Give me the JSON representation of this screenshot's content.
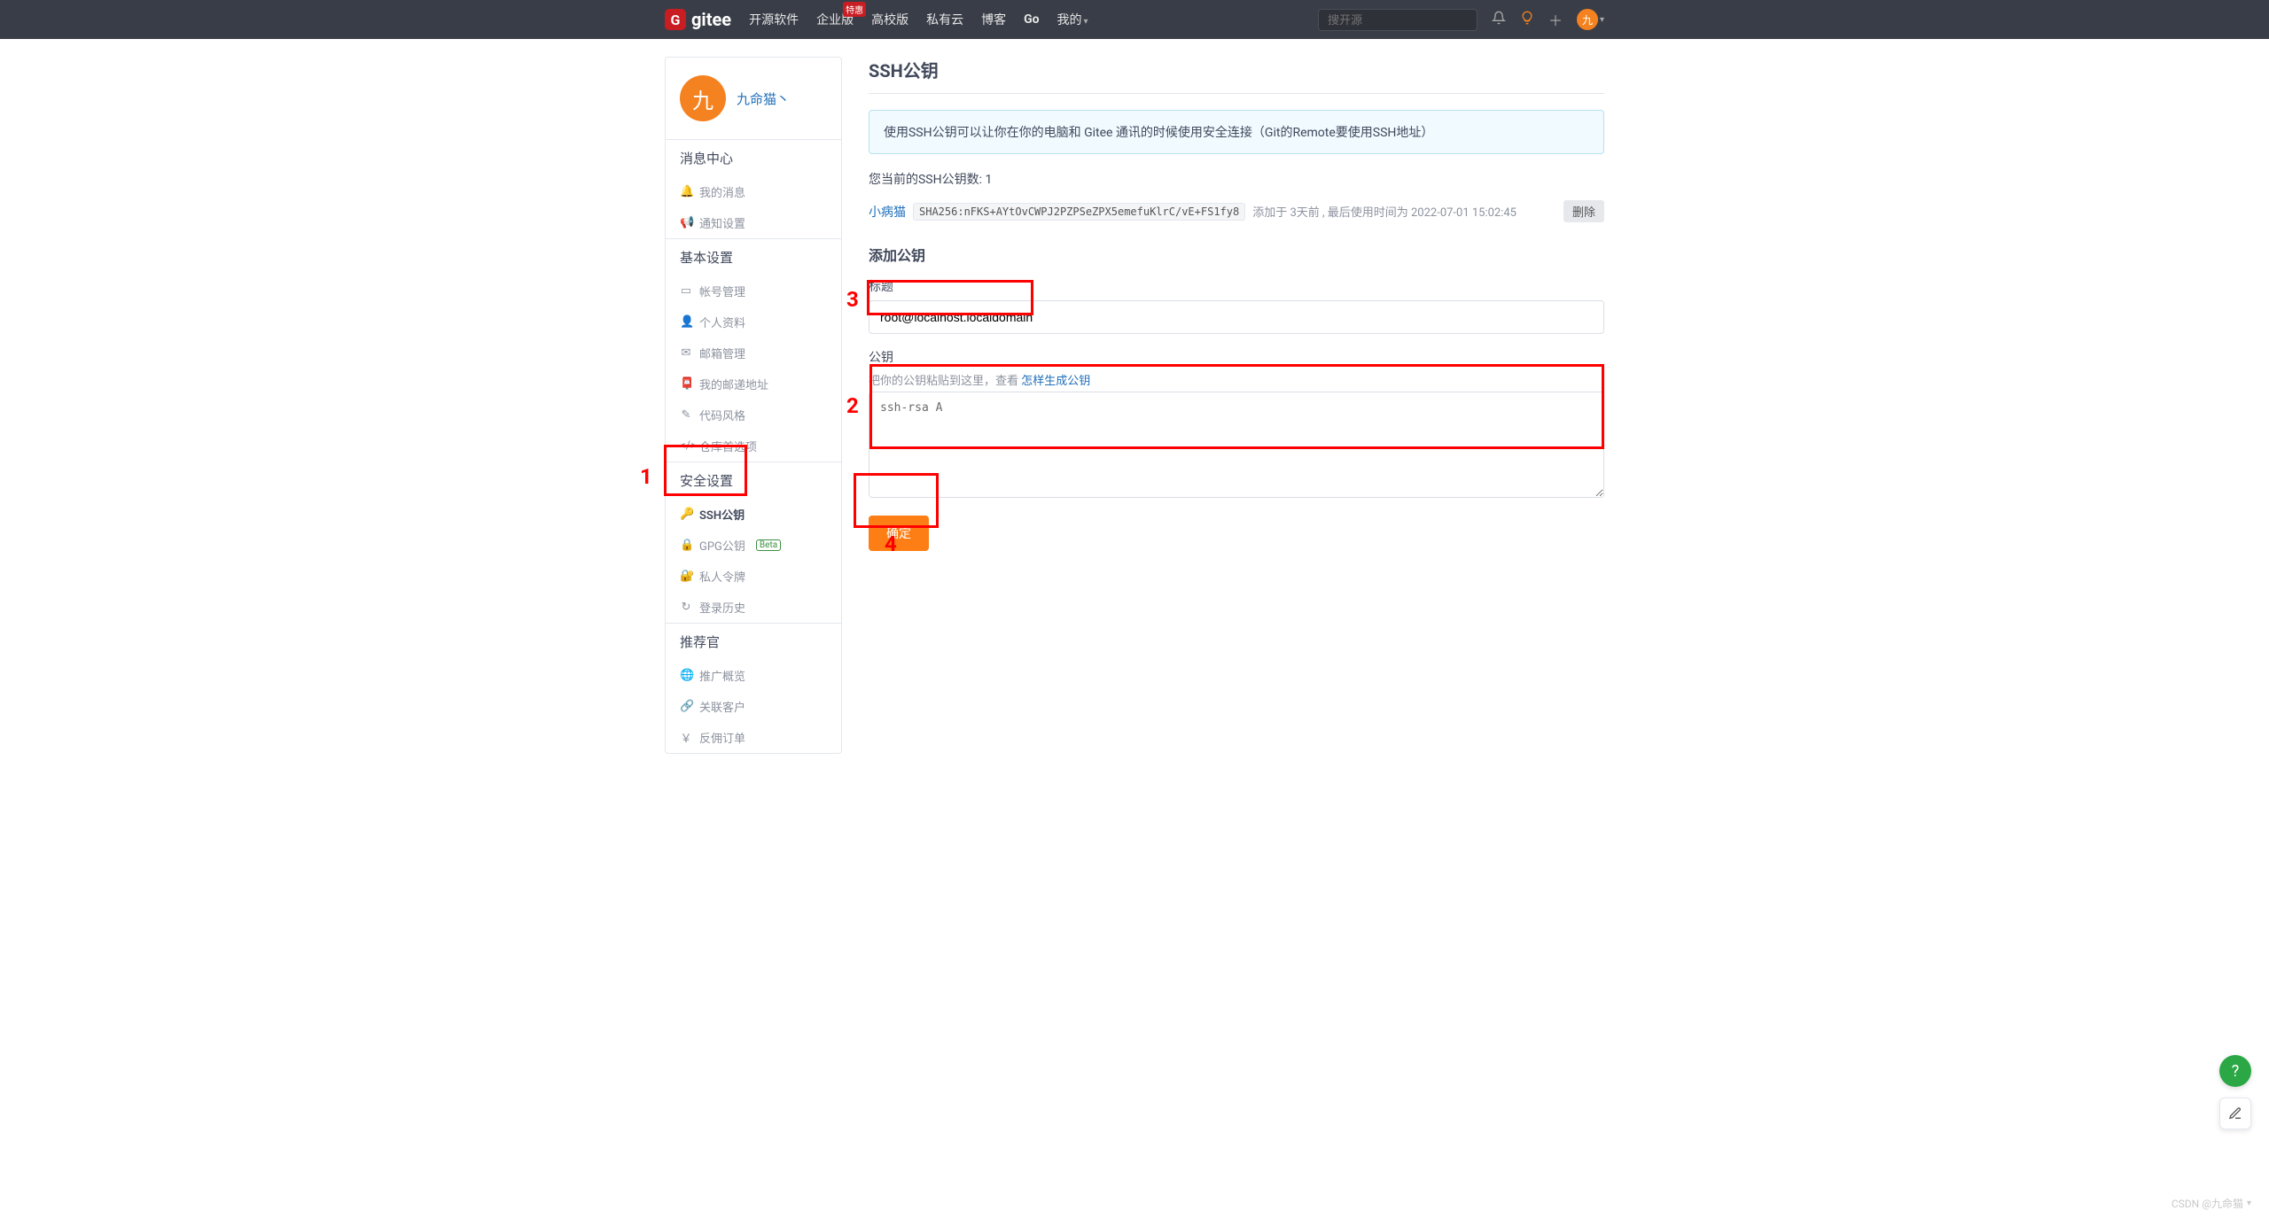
{
  "topbar": {
    "logo_text": "gitee",
    "nav": {
      "opensource": "开源软件",
      "enterprise": "企业版",
      "enterprise_badge": "特惠",
      "edu": "高校版",
      "private": "私有云",
      "blog": "博客",
      "go": "Go",
      "mine": "我的"
    },
    "search_placeholder": "搜开源",
    "avatar_char": "九"
  },
  "sidebar": {
    "username": "九命猫丶",
    "avatar_char": "九",
    "groups": {
      "msg_title": "消息中心",
      "msg_items": {
        "my_msg": "我的消息",
        "notify": "通知设置"
      },
      "basic_title": "基本设置",
      "basic_items": {
        "account": "帐号管理",
        "profile": "个人资料",
        "email": "邮箱管理",
        "mail_addr": "我的邮递地址",
        "code_style": "代码风格",
        "repo_prefs": "仓库首选项"
      },
      "security_title": "安全设置",
      "security_items": {
        "ssh": "SSH公钥",
        "gpg": "GPG公钥",
        "gpg_badge": "Beta",
        "token": "私人令牌",
        "login_history": "登录历史"
      },
      "referral_title": "推荐官",
      "referral_items": {
        "overview": "推广概览",
        "clients": "关联客户",
        "orders": "反佣订单"
      }
    }
  },
  "main": {
    "page_title": "SSH公钥",
    "info_text": "使用SSH公钥可以让你在你的电脑和 Gitee 通讯的时候使用安全连接（Git的Remote要使用SSH地址）",
    "key_count_label": "您当前的SSH公钥数: 1",
    "existing_key": {
      "name": "小病猫",
      "hash": "SHA256:nFKS+AYtOvCWPJ2PZPSeZPX5emefuKlrC/vE+FS1fy8",
      "meta": "添加于 3天前 , 最后使用时间为 2022-07-01 15:02:45",
      "delete": "删除"
    },
    "add_heading": "添加公钥",
    "title_label": "标题",
    "title_value": "root@localhost.localdomain",
    "key_label": "公钥",
    "key_help_prefix": "把你的公钥粘贴到这里，查看 ",
    "key_help_link": "怎样生成公钥",
    "key_value": "ssh-rsa A",
    "confirm": "确定"
  },
  "annotations": {
    "n1": "1",
    "n2": "2",
    "n3": "3",
    "n4": "4"
  },
  "watermark": "CSDN @九命猫"
}
